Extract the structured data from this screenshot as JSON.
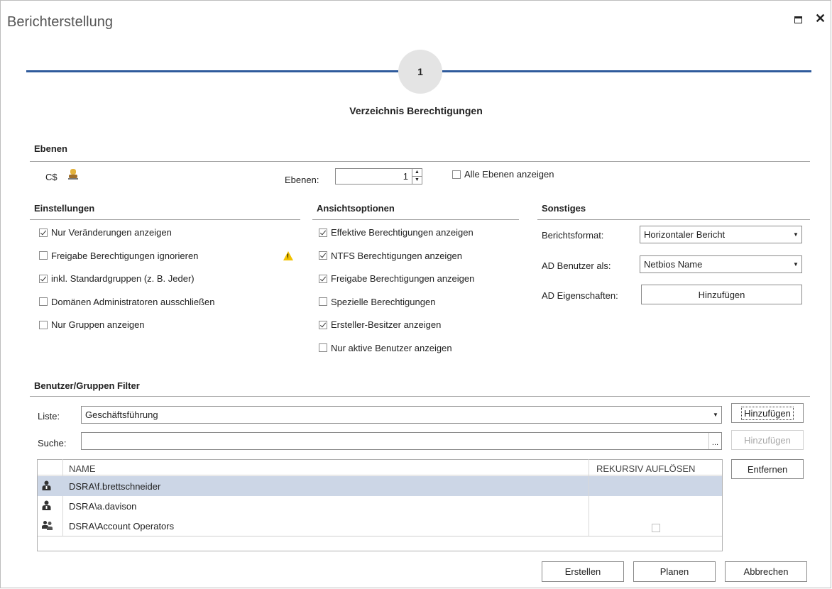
{
  "window": {
    "title": "Berichterstellung"
  },
  "wizard": {
    "step_number": "1",
    "step_title": "Verzeichnis Berechtigungen"
  },
  "ebenen": {
    "header": "Ebenen",
    "path": "C$",
    "levels_label": "Ebenen:",
    "levels_value": "1",
    "all_levels_label": "Alle Ebenen anzeigen",
    "all_levels_checked": false
  },
  "einstellungen": {
    "header": "Einstellungen",
    "items": [
      {
        "label": "Nur Veränderungen anzeigen",
        "checked": true
      },
      {
        "label": "Freigabe Berechtigungen ignorieren",
        "checked": false
      },
      {
        "label": "inkl. Standardgruppen (z. B. Jeder)",
        "checked": true
      },
      {
        "label": "Domänen Administratoren ausschließen",
        "checked": false
      },
      {
        "label": "Nur Gruppen anzeigen",
        "checked": false
      }
    ]
  },
  "ansicht": {
    "header": "Ansichtsoptionen",
    "items": [
      {
        "label": "Effektive Berechtigungen anzeigen",
        "checked": true
      },
      {
        "label": "NTFS Berechtigungen anzeigen",
        "checked": true
      },
      {
        "label": "Freigabe Berechtigungen anzeigen",
        "checked": true
      },
      {
        "label": "Spezielle Berechtigungen",
        "checked": false
      },
      {
        "label": "Ersteller-Besitzer anzeigen",
        "checked": true
      },
      {
        "label": "Nur aktive Benutzer anzeigen",
        "checked": false
      }
    ]
  },
  "sonstiges": {
    "header": "Sonstiges",
    "format_label": "Berichtsformat:",
    "format_value": "Horizontaler Bericht",
    "ad_user_label": "AD Benutzer als:",
    "ad_user_value": "Netbios Name",
    "ad_props_label": "AD Eigenschaften:",
    "ad_props_button": "Hinzufügen"
  },
  "filter": {
    "header": "Benutzer/Gruppen Filter",
    "list_label": "Liste:",
    "list_value": "Geschäftsführung",
    "list_add_button": "Hinzufügen",
    "search_label": "Suche:",
    "search_value": "",
    "search_browse": "...",
    "search_add_button": "Hinzufügen",
    "remove_button": "Entfernen",
    "columns": {
      "name": "NAME",
      "recursive": "REKURSIV AUFLÖSEN"
    },
    "rows": [
      {
        "name": "DSRA\\f.brettschneider",
        "type": "user-icon",
        "selected": true,
        "recursive": null
      },
      {
        "name": "DSRA\\a.davison",
        "type": "user-icon",
        "selected": false,
        "recursive": null
      },
      {
        "name": "DSRA\\Account Operators",
        "type": "group-icon",
        "selected": false,
        "recursive": false
      }
    ]
  },
  "footer": {
    "create": "Erstellen",
    "schedule": "Planen",
    "cancel": "Abbrechen"
  },
  "colors": {
    "accent": "#2f5b9c",
    "selected_row": "#ccd6e6",
    "warning": "#f2c200"
  }
}
